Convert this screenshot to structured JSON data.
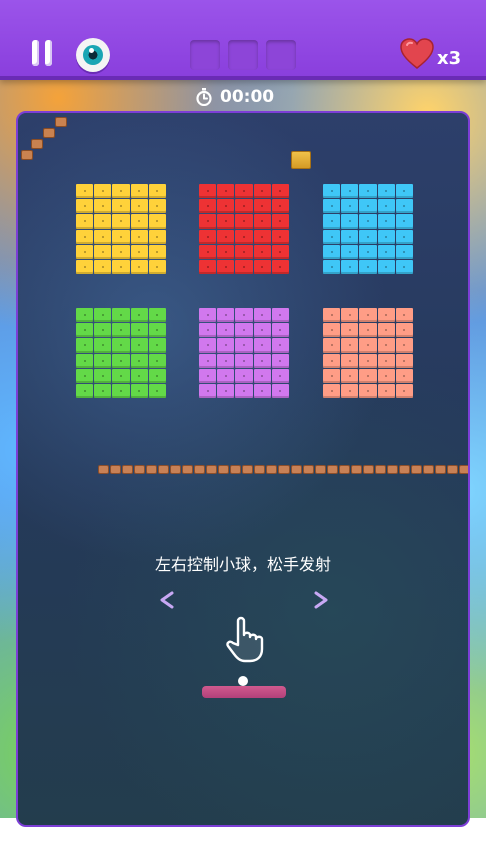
{
  "topbar": {
    "pause_icon": "pause-icon",
    "vision_icon": "eye-icon",
    "powerup_slots": 3,
    "lives_icon": "heart-icon",
    "lives": "x3",
    "accent": "#8a3fdd"
  },
  "timer": {
    "icon": "stopwatch-icon",
    "value": "00:00"
  },
  "board": {
    "brick_colors": [
      "#ffd23a",
      "#ee3234",
      "#3fc7f7",
      "#63d948",
      "#d178ee",
      "#ff9d86"
    ],
    "hint": "左右控制小球，松手发射",
    "gesture_icon": "hand-pointer-icon",
    "arrows_icon": "left-right-arrows-icon"
  }
}
